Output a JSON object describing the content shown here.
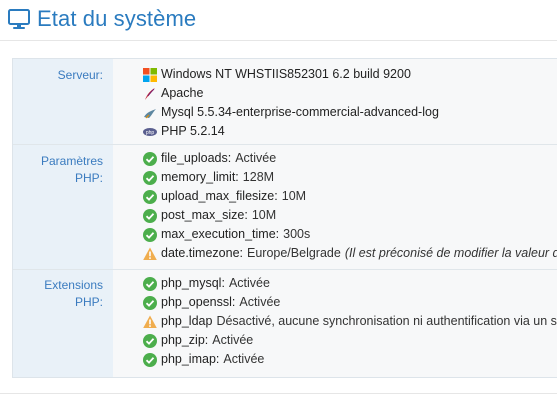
{
  "header": {
    "title": "Etat du système",
    "icon": "monitor-icon",
    "title_color": "#2a7bbf"
  },
  "server": {
    "label": "Serveur:",
    "items": [
      {
        "icon": "windows-logo-icon",
        "text": "Windows NT WHSTIIS852301 6.2 build 9200"
      },
      {
        "icon": "apache-feather-icon",
        "text": "Apache"
      },
      {
        "icon": "mysql-logo-icon",
        "text": "Mysql 5.5.34-enterprise-commercial-advanced-log"
      },
      {
        "icon": "php-logo-icon",
        "text": "PHP 5.2.14"
      }
    ]
  },
  "params": {
    "label_line1": "Paramètres",
    "label_line2": "PHP:",
    "items": [
      {
        "status": "ok",
        "key": "file_uploads:",
        "value": "Activée",
        "note": ""
      },
      {
        "status": "ok",
        "key": "memory_limit:",
        "value": "128M",
        "note": ""
      },
      {
        "status": "ok",
        "key": "upload_max_filesize:",
        "value": "10M",
        "note": ""
      },
      {
        "status": "ok",
        "key": "post_max_size:",
        "value": "10M",
        "note": ""
      },
      {
        "status": "ok",
        "key": "max_execution_time:",
        "value": "300s",
        "note": ""
      },
      {
        "status": "warn",
        "key": "date.timezone:",
        "value": "Europe/Belgrade",
        "note": "(Il est préconisé de modifier la valeur da"
      }
    ]
  },
  "extensions": {
    "label": "Extensions PHP:",
    "items": [
      {
        "status": "ok",
        "key": "php_mysql:",
        "value": "Activée"
      },
      {
        "status": "ok",
        "key": "php_openssl:",
        "value": "Activée"
      },
      {
        "status": "warn",
        "key": "php_ldap",
        "value": "Désactivé, aucune synchronisation ni authentification via un se"
      },
      {
        "status": "ok",
        "key": "php_zip:",
        "value": "Activée"
      },
      {
        "status": "ok",
        "key": "php_imap:",
        "value": "Activée"
      }
    ]
  },
  "colors": {
    "ok": "#4cae4c",
    "warn": "#f0ad4e",
    "label": "#3a7bbf",
    "label_bg": "#e9f1f8"
  }
}
